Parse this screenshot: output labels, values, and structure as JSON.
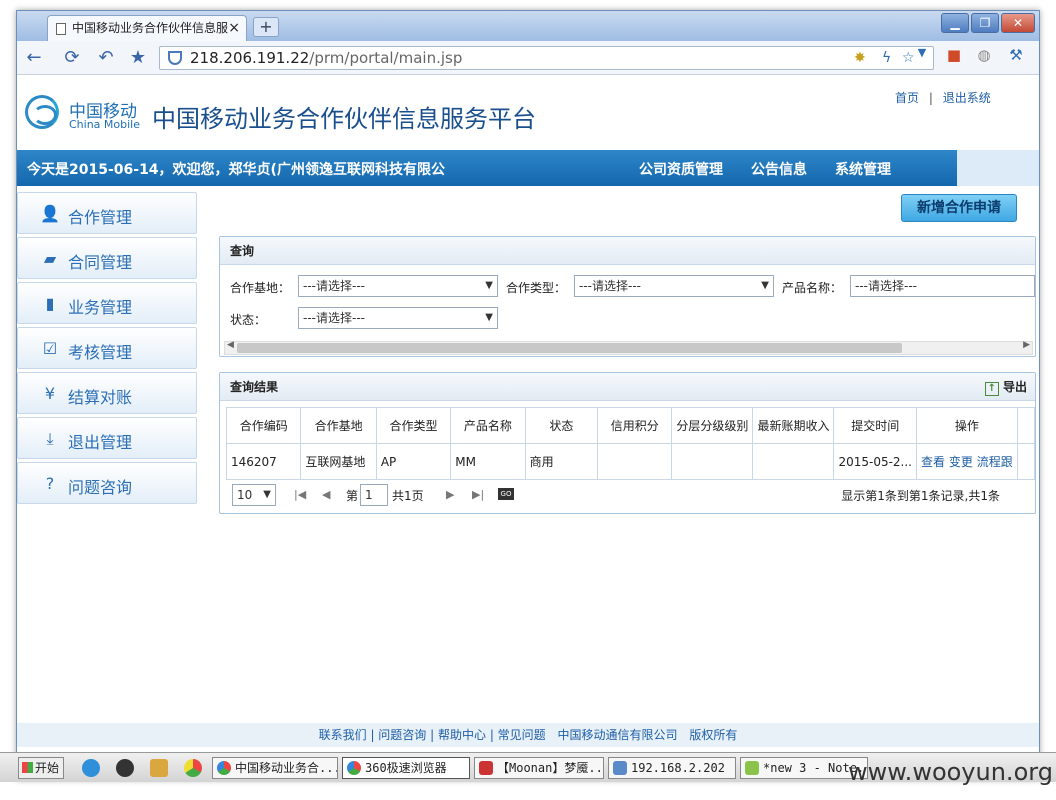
{
  "browser": {
    "tab_title": "中国移动业务合作伙伴信息服",
    "tab_close": "×",
    "new_tab": "+",
    "url_domain": "218.206.191.22",
    "url_path": "/prm/portal/main.jsp"
  },
  "header": {
    "logo_cn": "中国移动",
    "logo_en": "China Mobile",
    "title": "中国移动业务合作伙伴信息服务平台",
    "links": [
      "首页",
      "退出系统"
    ]
  },
  "bluebar": {
    "welcome": "今天是2015-06-14，欢迎您，郑华贞(广州领逸互联网科技有限公",
    "nav": [
      "公司资质管理",
      "公告信息",
      "系统管理"
    ]
  },
  "sidebar": {
    "items": [
      {
        "label": "合作管理",
        "icon": "user-icon"
      },
      {
        "label": "合同管理",
        "icon": "folder-icon"
      },
      {
        "label": "业务管理",
        "icon": "book-icon"
      },
      {
        "label": "考核管理",
        "icon": "check-icon"
      },
      {
        "label": "结算对账",
        "icon": "yen-icon"
      },
      {
        "label": "退出管理",
        "icon": "download-icon"
      },
      {
        "label": "问题咨询",
        "icon": "question-icon"
      }
    ]
  },
  "add_button": "新增合作申请",
  "query": {
    "title": "查询",
    "fields": [
      {
        "label": "合作基地：",
        "value": "---请选择---"
      },
      {
        "label": "合作类型：",
        "value": "---请选择---"
      },
      {
        "label": "产品名称：",
        "value": "---请选择---"
      },
      {
        "label": "状态：",
        "value": "---请选择---"
      }
    ]
  },
  "results": {
    "title": "查询结果",
    "export": "导出",
    "columns": [
      "合作编码",
      "合作基地",
      "合作类型",
      "产品名称",
      "状态",
      "信用积分",
      "分层分级级别",
      "最新账期收入",
      "提交时间",
      "操作"
    ],
    "rows": [
      {
        "code": "146207",
        "base": "互联网基地",
        "type": "AP",
        "product": "MM",
        "status": "商用",
        "credit": "",
        "level": "",
        "income": "",
        "time": "2015-05-2...",
        "actions": [
          "查看",
          "变更",
          "流程跟"
        ]
      }
    ],
    "pager": {
      "page_size": "10",
      "page_prefix": "第",
      "page": "1",
      "total_pages": "共1页",
      "go": "GO",
      "summary": "显示第1条到第1条记录,共1条"
    }
  },
  "footer": {
    "links": [
      "联系我们",
      "问题咨询",
      "帮助中心",
      "常见问题",
      "中国移动通信有限公司",
      "版权所有"
    ]
  },
  "taskbar": {
    "start": "开始",
    "items": [
      "中国移动业务合...",
      "360极速浏览器",
      "【Moonan】梦魇...",
      "192.168.2.202 ...",
      "*new  3 - Note..."
    ],
    "watermark": "www.wooyun.org"
  },
  "colors": {
    "primary": "#1467ad",
    "link": "#1d5fa6",
    "accent": "#3fa8e4"
  }
}
